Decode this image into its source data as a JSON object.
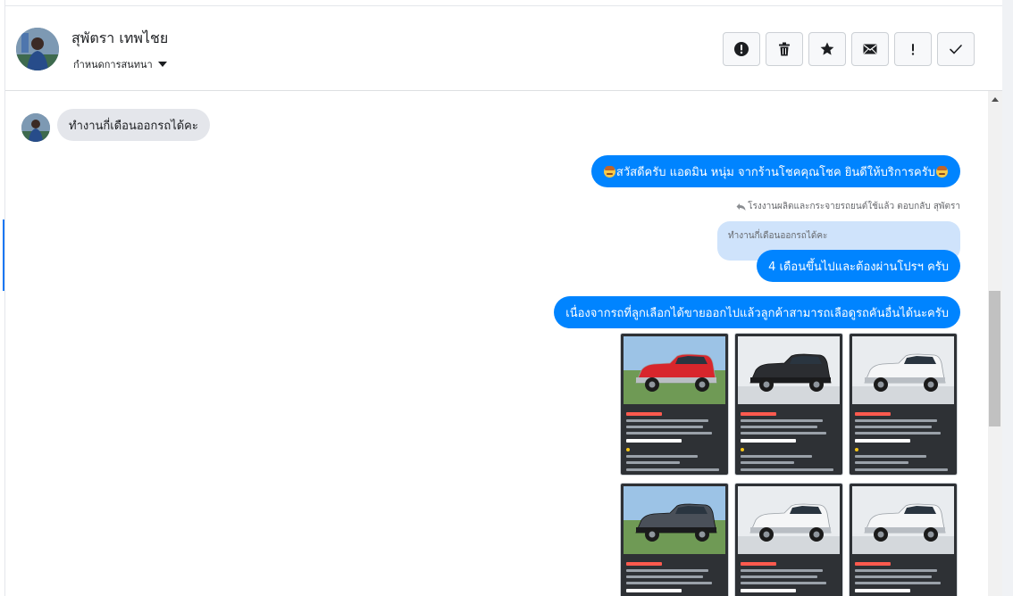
{
  "header": {
    "contact_name": "สุพัตรา เทพไชย",
    "conversation_setting": "กำหนดการสนทนา"
  },
  "toolbar": [
    {
      "name": "alert-circle",
      "icon": "exclamation-circle-icon"
    },
    {
      "name": "delete",
      "icon": "trash-icon"
    },
    {
      "name": "star",
      "icon": "star-icon"
    },
    {
      "name": "mail",
      "icon": "envelope-icon"
    },
    {
      "name": "important",
      "icon": "exclamation-icon"
    },
    {
      "name": "done",
      "icon": "check-icon"
    }
  ],
  "messages": {
    "incoming_1": "ทำงานกี่เดือนออกรถได้คะ",
    "outgoing_greeting": "สวัสดีครับ แอดมิน หนุ่ม จากร้านโชคคุณโชค ยินดีให้บริการครับ",
    "reply_note": "โรงงานผลิตและกระจายรถยนต์ใช้แล้ว ตอบกลับ สุพัตรา",
    "quoted_text": "ทำงานกี่เดือนออกรถได้คะ",
    "outgoing_answer": "4 เดือนขึ้นไปและต้องผ่านโปรฯ ครับ",
    "outgoing_offer": "เนื่องจากรถที่ลูกเลือกได้ขายออกไปแล้วลูกค้าสามารถเลือดูรถคันอื่นได้นะครับ"
  },
  "car_cards": [
    {
      "color": "#d8262c"
    },
    {
      "color": "#2b2d31"
    },
    {
      "color": "#f5f6f7"
    },
    {
      "color": "#4a5059"
    },
    {
      "color": "#f5f6f7"
    },
    {
      "color": "#f5f6f7"
    }
  ],
  "colors": {
    "outgoing_bubble": "#0084ff",
    "incoming_bubble": "#e4e6eb",
    "quoted_bubble": "#cfe3fb"
  }
}
